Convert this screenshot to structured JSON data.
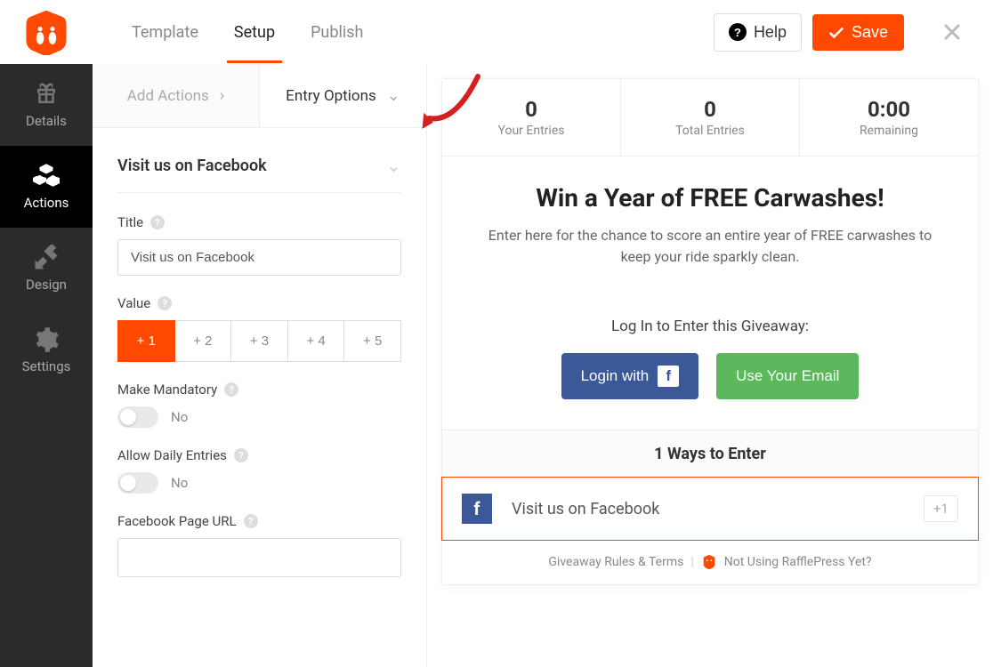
{
  "header": {
    "tabs": {
      "template": "Template",
      "setup": "Setup",
      "publish": "Publish"
    },
    "help": "Help",
    "save": "Save"
  },
  "sidenav": {
    "details": "Details",
    "actions": "Actions",
    "design": "Design",
    "settings": "Settings"
  },
  "panel": {
    "tabs": {
      "add": "Add Actions",
      "entry": "Entry Options"
    },
    "section_title": "Visit us on Facebook",
    "fields": {
      "title_label": "Title",
      "title_value": "Visit us on Facebook",
      "value_label": "Value",
      "value_options": [
        "+ 1",
        "+ 2",
        "+ 3",
        "+ 4",
        "+ 5"
      ],
      "value_selected": 0,
      "mandatory_label": "Make Mandatory",
      "mandatory_state": "No",
      "daily_label": "Allow Daily Entries",
      "daily_state": "No",
      "url_label": "Facebook Page URL",
      "url_value": ""
    }
  },
  "preview": {
    "stats": [
      {
        "value": "0",
        "label": "Your Entries"
      },
      {
        "value": "0",
        "label": "Total Entries"
      },
      {
        "value": "0:00",
        "label": "Remaining"
      }
    ],
    "headline": "Win a Year of FREE Carwashes!",
    "subhead": "Enter here for the chance to score an entire year of FREE carwashes to keep your ride sparkly clean.",
    "login_prompt": "Log In to Enter this Giveaway:",
    "login_fb": "Login with",
    "login_email": "Use Your Email",
    "ways_header": "1 Ways to Enter",
    "entry": {
      "label": "Visit us on Facebook",
      "value": "+1"
    },
    "footer": {
      "rules": "Giveaway Rules & Terms",
      "not_using": "Not Using RafflePress Yet?"
    }
  }
}
